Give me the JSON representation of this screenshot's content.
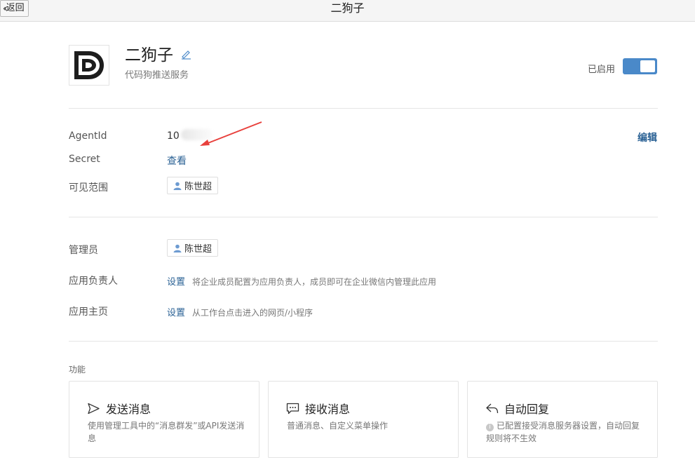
{
  "topbar": {
    "back_label": "返回",
    "title": "二狗子"
  },
  "app": {
    "name": "二狗子",
    "description": "代码狗推送服务",
    "status_label": "已启用",
    "enabled": true
  },
  "details": {
    "agentid_label": "AgentId",
    "agentid_value": "10",
    "edit_label": "编辑",
    "secret_label": "Secret",
    "secret_action": "查看",
    "visible_label": "可见范围",
    "visible_member": "陈世超"
  },
  "admin": {
    "admin_label": "管理员",
    "admin_member": "陈世超",
    "owner_label": "应用负责人",
    "owner_action": "设置",
    "owner_hint": "将企业成员配置为应用负责人，成员即可在企业微信内管理此应用",
    "homepage_label": "应用主页",
    "homepage_action": "设置",
    "homepage_hint": "从工作台点击进入的网页/小程序"
  },
  "features": {
    "section_title": "功能",
    "cards": [
      {
        "title": "发送消息",
        "icon": "send-icon",
        "desc": "使用管理工具中的“消息群发”或API发送消息"
      },
      {
        "title": "接收消息",
        "icon": "chat-icon",
        "desc": "普通消息、自定义菜单操作"
      },
      {
        "title": "自动回复",
        "icon": "reply-icon",
        "desc": "已配置接受消息服务器设置，自动回复规则将不生效",
        "info_icon": "i"
      }
    ]
  },
  "colors": {
    "accent": "#4a89c9",
    "link": "#2b6295",
    "annotation_arrow": "#e8403c"
  }
}
